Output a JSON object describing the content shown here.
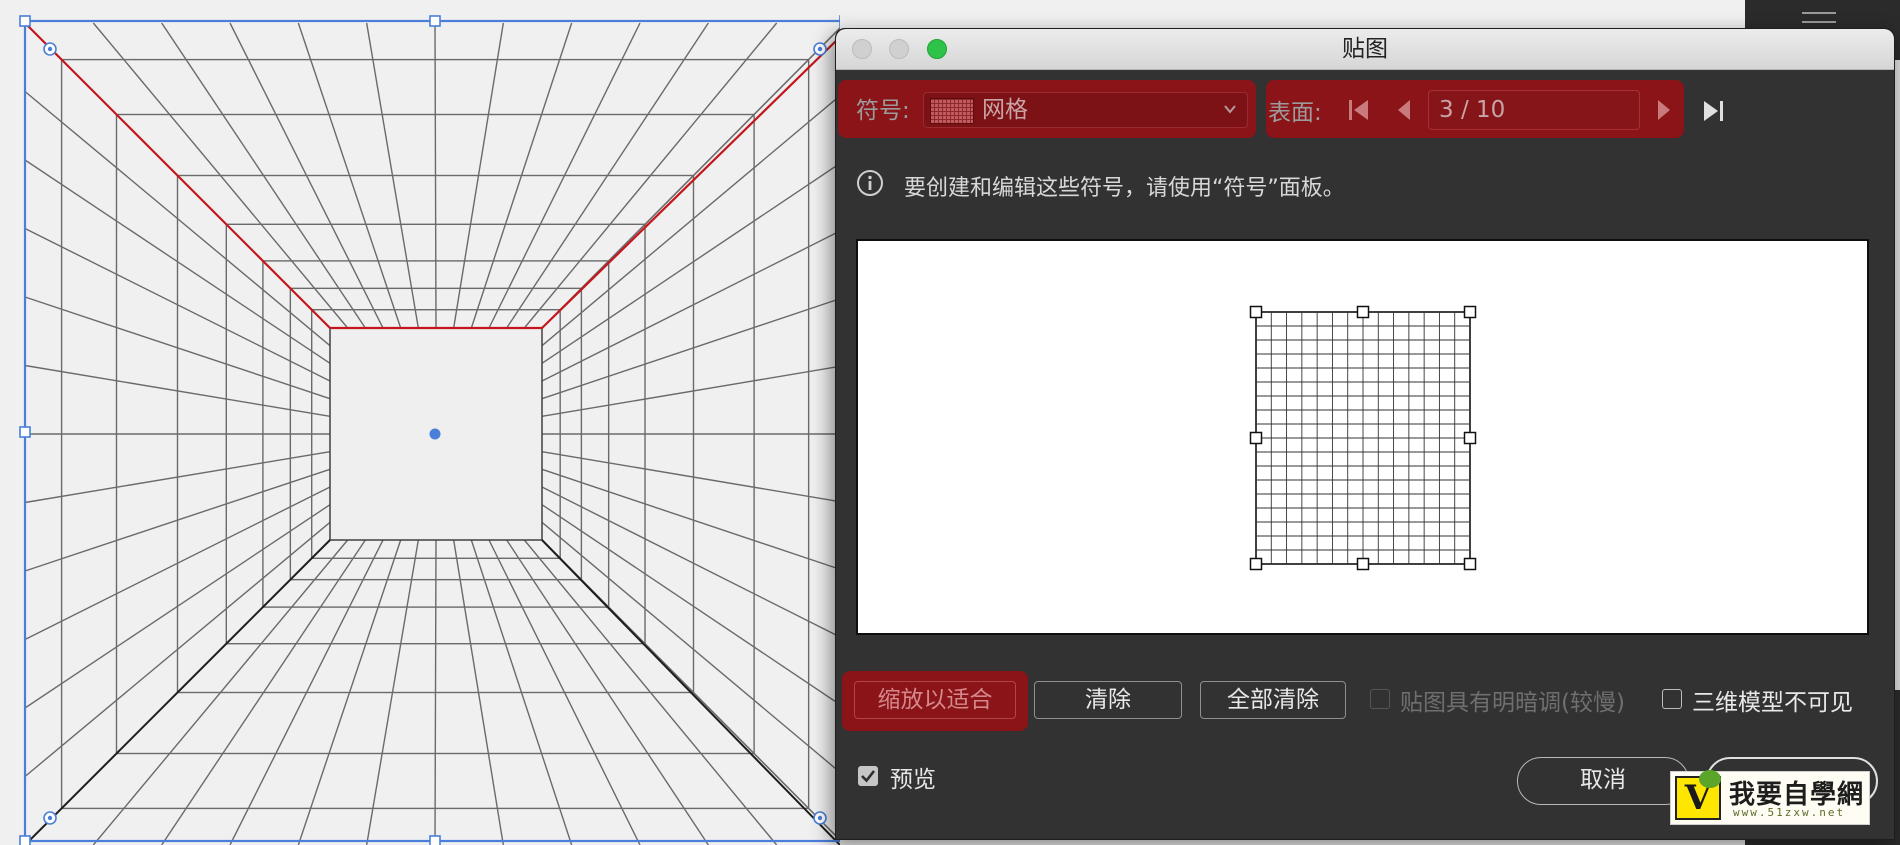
{
  "dialog": {
    "title": "贴图",
    "symbol": {
      "label": "符号:",
      "value": "网格"
    },
    "surface": {
      "label": "表面:",
      "value": "3 / 10"
    },
    "info_text": "要创建和编辑这些符号，请使用“符号”面板。",
    "buttons": {
      "scale_to_fit": "缩放以适合",
      "clear": "清除",
      "clear_all": "全部清除",
      "cancel": "取消"
    },
    "options": {
      "shade_artwork": {
        "label": "贴图具有明暗调(较慢)",
        "checked": false,
        "enabled": false
      },
      "invisible_geometry": {
        "label": "三维模型不可见",
        "checked": false
      },
      "preview": {
        "label": "预览",
        "checked": true
      }
    }
  },
  "colors": {
    "highlight": "#8a1418",
    "canvas_bg": "#f0f0f0",
    "selection": "#4a7fd9",
    "dialog_bg": "#323232"
  },
  "watermark": {
    "name": "我要自學網",
    "url": "www.51zxw.net",
    "icon": "v-leaf-logo"
  }
}
